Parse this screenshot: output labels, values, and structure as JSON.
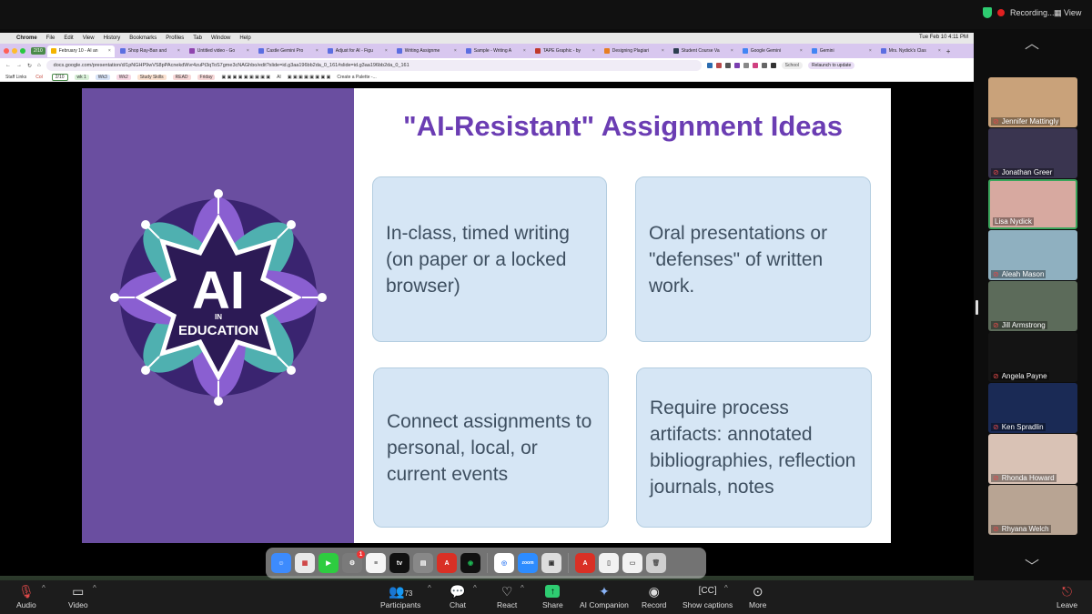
{
  "zoom_top": {
    "recording": "Recording...",
    "view": "View"
  },
  "mac_menubar": {
    "items": [
      "Chrome",
      "File",
      "Edit",
      "View",
      "History",
      "Bookmarks",
      "Profiles",
      "Tab",
      "Window",
      "Help"
    ],
    "clock": "Tue Feb 10  4:11 PM"
  },
  "browser": {
    "tab_group": "2/10",
    "tabs": [
      "February 10 - AI an",
      "Shop Ray-Ban and",
      "Untitled video - Go",
      "Castle Gemini Pro",
      "Adjust for AI - Figu",
      "Writing Assignme",
      "Sample - Writing A",
      "TAPE Graphic - by",
      "Designing Plagiari",
      "Student Course Va",
      "Google Gemini",
      "Gemini",
      "Mrs. Nydick's Clas"
    ],
    "url": "docs.google.com/presentation/d/1pNGHP9wVS8pPAcnekdWvr4zuPt3qToS7gme3cNAGhbo/edit?slide=id.g3aa196bb2da_0_161#slide=id.g3aa196bb2da_0_161",
    "school": "School",
    "relaunch": "Relaunch to update"
  },
  "bookmarks": [
    "Staff Links",
    "Col",
    "2/10",
    "wk 1",
    "Wk3",
    "Wk2",
    "Study Skills",
    "READ",
    "Friday",
    "AI",
    "Create a Palette -..."
  ],
  "slide": {
    "title": "\"AI-Resistant\" Assignment Ideas",
    "logo_main": "AI",
    "logo_in": "IN",
    "logo_education": "EDUCATION",
    "cards": [
      "In-class, timed writing (on paper or a locked browser)",
      "Oral presentations or \"defenses\" of written work.",
      "Connect assignments to personal, local, or current events",
      "Require process artifacts: annotated bibliographies, reflection journals, notes"
    ]
  },
  "dock": {
    "tv_label": "tv",
    "zoom_label": "zoom",
    "badge": "1"
  },
  "participants": [
    {
      "name": "Jennifer Mattingly",
      "bg": "#c9a27a"
    },
    {
      "name": "Jonathan Greer",
      "bg": "#3a3550"
    },
    {
      "name": "Lisa Nydick",
      "bg": "#d7a9a0"
    },
    {
      "name": "Aleah Mason",
      "bg": "#8fb0c0"
    },
    {
      "name": "Jill Armstrong",
      "bg": "#5c6b5a"
    },
    {
      "name": "Angela Payne",
      "bg": "#141414"
    },
    {
      "name": "Ken Spradlin",
      "bg": "#1a2a55"
    },
    {
      "name": "Rhonda Howard",
      "bg": "#d9c2b5"
    },
    {
      "name": "Rhyana Welch",
      "bg": "#b8a493"
    }
  ],
  "toolbar": {
    "audio": "Audio",
    "video": "Video",
    "participants": "Participants",
    "participants_count": "73",
    "chat": "Chat",
    "react": "React",
    "share": "Share",
    "ai_companion": "AI Companion",
    "record": "Record",
    "captions": "Show captions",
    "more": "More",
    "leave": "Leave"
  }
}
